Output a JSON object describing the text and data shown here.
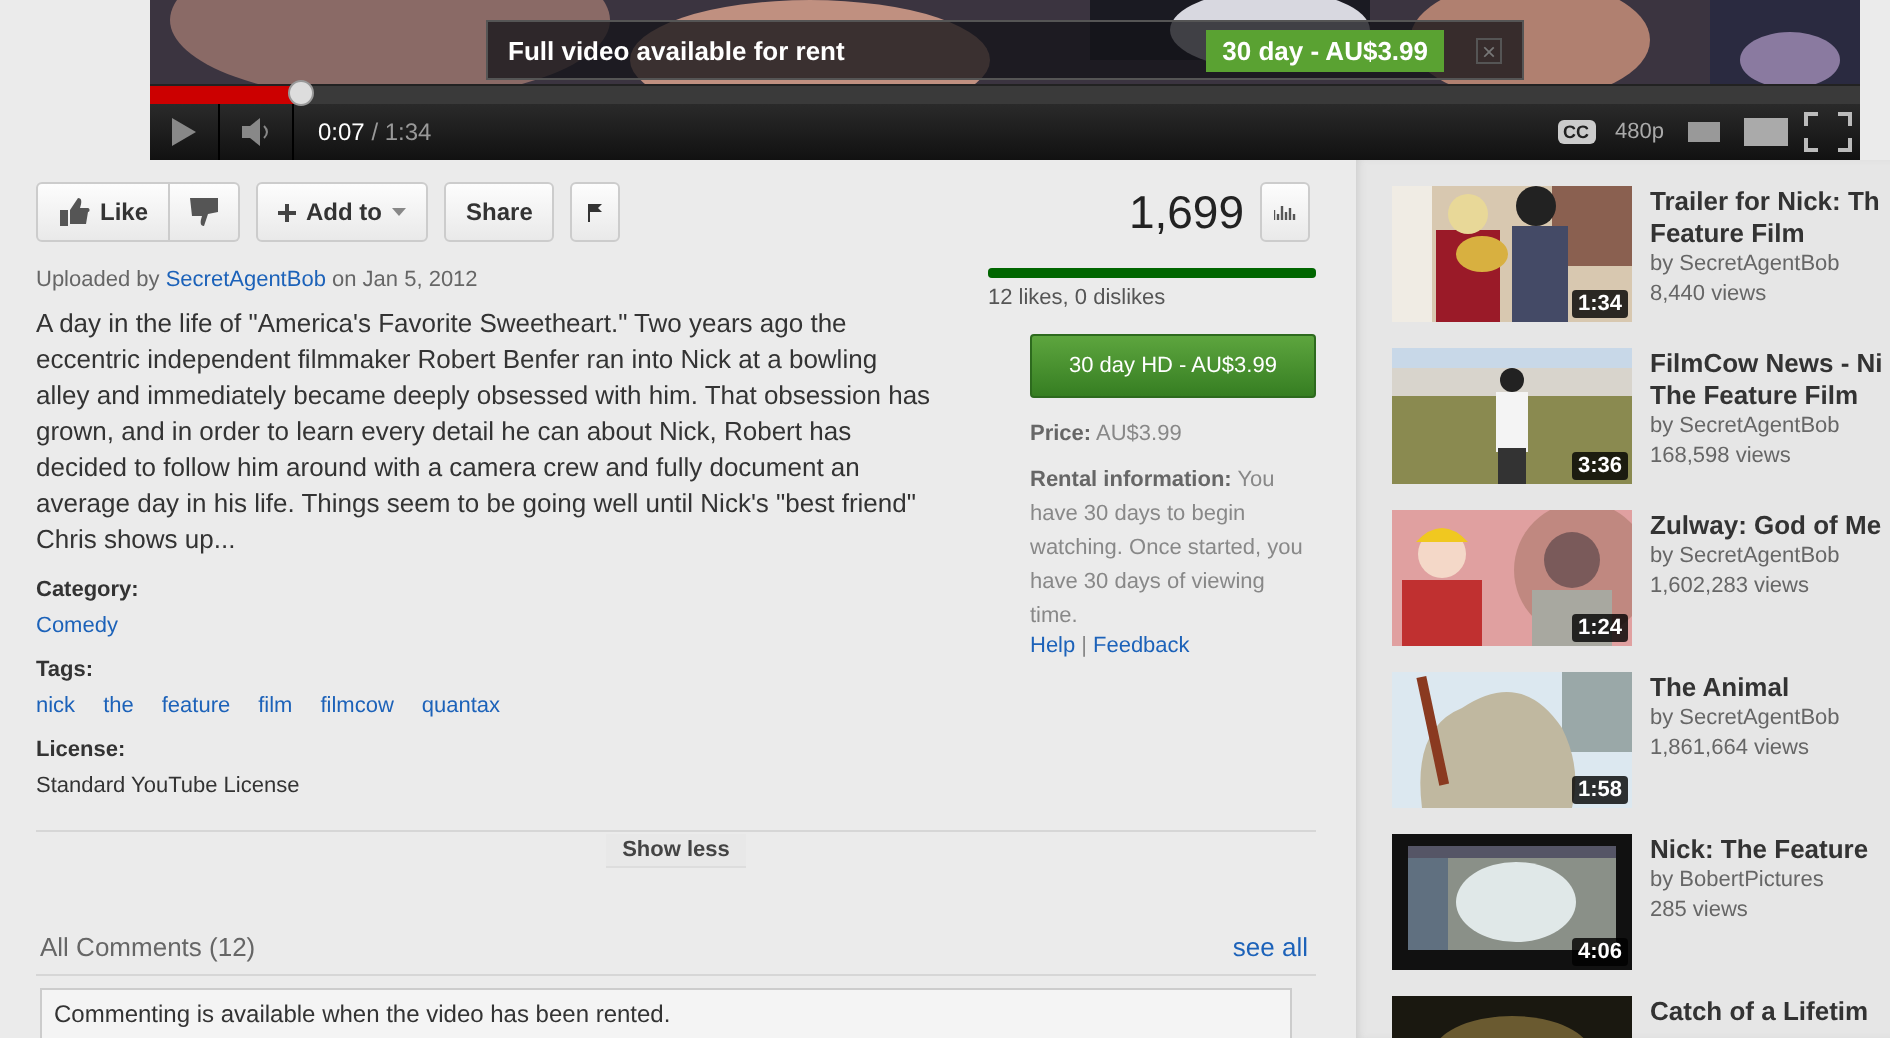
{
  "player": {
    "overlay": {
      "message": "Full video available for rent",
      "rent_button": "30 day - AU$3.99",
      "close": "×"
    },
    "progress": {
      "level": 0.088
    },
    "time_current": "0:07",
    "time_total": "/ 1:34",
    "cc": "CC",
    "quality": "480p"
  },
  "actions": {
    "like": "Like",
    "add_to": "Add to",
    "share": "Share"
  },
  "view_count": "1,699",
  "uploader": {
    "prefix": "Uploaded by",
    "name": "SecretAgentBob",
    "date": "on Jan 5, 2012"
  },
  "description": "A day in the life of \"America's Favorite Sweetheart.\" Two years ago the eccentric independent filmmaker Robert Benfer ran into Nick at a bowling alley and immediately became deeply obsessed with him. That obsession has grown, and in order to learn every detail he can about Nick, Robert has decided to follow him around with a camera crew and fully document an average day in his life. Things seem to be going well until Nick's \"best friend\" Chris shows up...",
  "category": {
    "label": "Category:",
    "value": "Comedy"
  },
  "tags": {
    "label": "Tags:",
    "items": [
      "nick",
      "the",
      "feature",
      "film",
      "filmcow",
      "quantax"
    ]
  },
  "license": {
    "label": "License:",
    "value": "Standard YouTube License"
  },
  "show_less": "Show less",
  "rating": {
    "level": 1,
    "text": "12 likes, 0 dislikes"
  },
  "rental": {
    "button": "30 day HD - AU$3.99",
    "price": "**Price:** AU$3.99",
    "info": "**Rental information:** You have 30 days to begin watching. Once started, you have 30 days of viewing time.",
    "links": [
      "Help",
      "Feedback"
    ],
    "separator": "|"
  },
  "comments": {
    "title": "All Comments (12)",
    "see_all": "see all",
    "notice": "Commenting is available when the video has been rented."
  },
  "related": [
    {
      "title_lines": [
        "Trailer for Nick: Th",
        "Feature Film"
      ],
      "author": "by SecretAgentBob",
      "views": "8,440 views",
      "duration": "1:34"
    },
    {
      "title_lines": [
        "FilmCow News - Ni",
        "The Feature Film"
      ],
      "author": "by SecretAgentBob",
      "views": "168,598 views",
      "duration": "3:36"
    },
    {
      "title_lines": [
        "Zulway: God of Me"
      ],
      "author": "by SecretAgentBob",
      "views": "1,602,283 views",
      "duration": "1:24"
    },
    {
      "title_lines": [
        "The Animal"
      ],
      "author": "by SecretAgentBob",
      "views": "1,861,664 views",
      "duration": "1:58"
    },
    {
      "title_lines": [
        "Nick: The Feature"
      ],
      "author": "by BobertPictures",
      "views": "285 views",
      "duration": "4:06"
    },
    {
      "title_lines": [
        "Catch of a Lifetim"
      ]
    }
  ]
}
